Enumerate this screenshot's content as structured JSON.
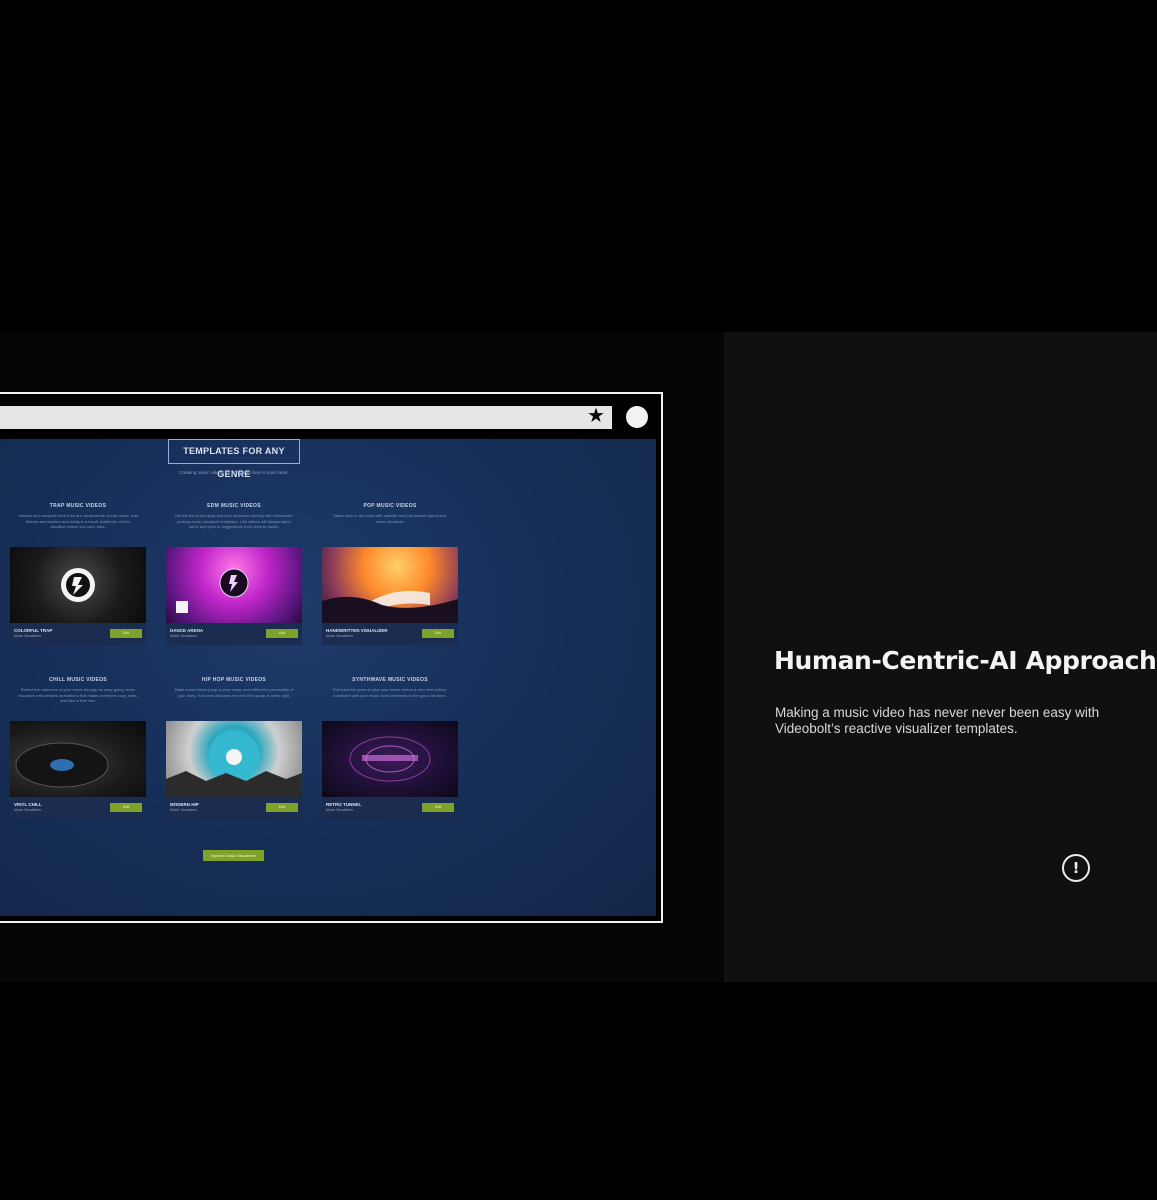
{
  "panel": {
    "headline": "Human-Centric-AI Approach",
    "description": "Making a music video has never never been easy with Videobolt’s reactive visualizer templates.",
    "info_icon": "info-icon"
  },
  "browser": {
    "star_icon": "star-icon",
    "avatar_icon": "avatar-icon"
  },
  "site": {
    "heading": "TEMPLATES FOR ANY GENRE",
    "subheading": "Creating music videos for one style close to your heart.",
    "columns": [
      {
        "title": "TRAP MUSIC VIDEOS",
        "desc": "Smooth and complete here than are components of trap music. Add themes are stacked and ready in a result. Authentic vivid to visualize videos you can’t miss."
      },
      {
        "title": "EDM MUSIC VIDEOS",
        "desc": "Get the blood pumping and your audience dancing with Videobolt’s pulsing music visualizer templates. Use videos will always stand out to any eyes or suggestions from ones to tastes."
      },
      {
        "title": "POP MUSIC VIDEOS",
        "desc": "Stand back in the room with satellite and pop smaller speed one music visualizer."
      },
      {
        "title": "CHILL MUSIC VIDEOS",
        "desc": "Reflect the calmness of your music through an easy-going music visualizer with detailed animations that makes everyone cozy, relax, and take a free rest."
      },
      {
        "title": "HIP HOP MUSIC VIDEOS",
        "desc": "Make some tribute jump at your music and reflect the personality of your story. Your fans will know the real 90’s quote at a few right."
      },
      {
        "title": "SYNTHWAVE MUSIC VIDEOS",
        "desc": "Roll back the years to give your music videos a retro feel edition, combined with your music video elements to the good old times."
      }
    ],
    "cards": [
      {
        "name": "COLORFUL TRAP",
        "type": "Music Visualizers",
        "button": "Edit"
      },
      {
        "name": "DANCE ARENA",
        "type": "Music Visualizers",
        "button": "Edit"
      },
      {
        "name": "HANDWRITTEN VISUALIZER",
        "type": "Music Visualizers",
        "button": "Edit"
      },
      {
        "name": "VINYL CHILL",
        "type": "Music Visualizers",
        "button": "Edit"
      },
      {
        "name": "MODERN HIP",
        "type": "Music Visualizers",
        "button": "Edit"
      },
      {
        "name": "RETRO TUNNEL",
        "type": "Music Visualizers",
        "button": "Edit"
      }
    ],
    "explore_button": "Explore Music Visualizers"
  }
}
